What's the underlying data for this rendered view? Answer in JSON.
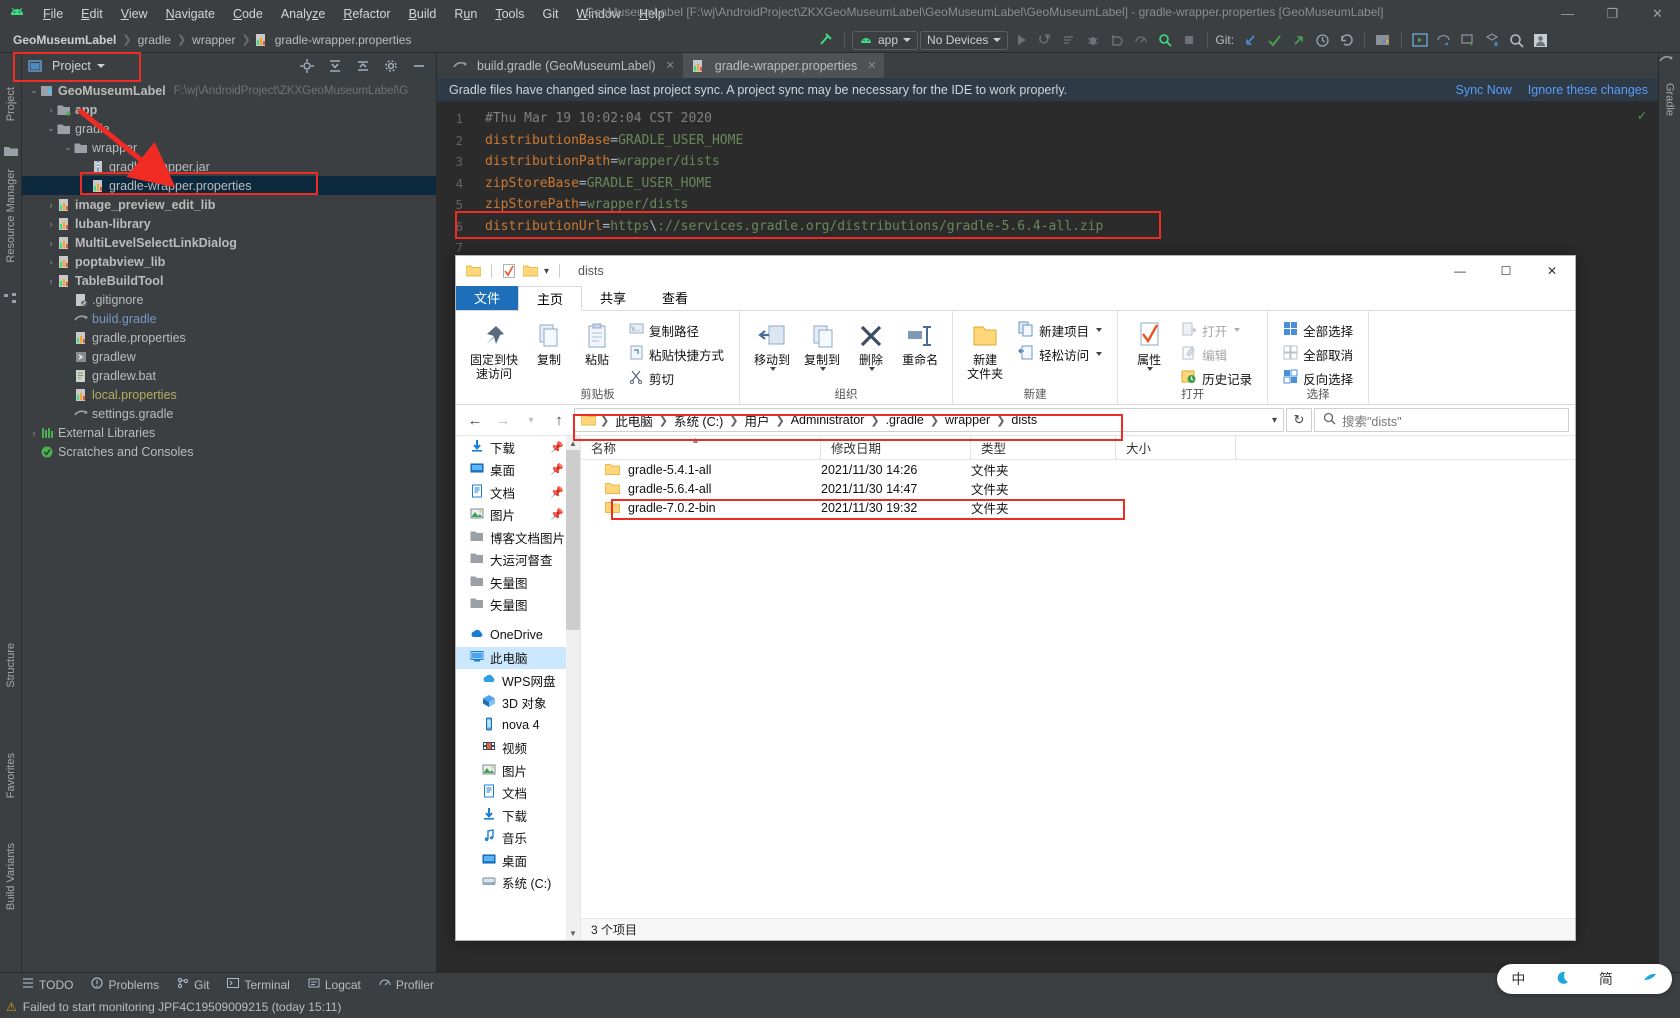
{
  "ide": {
    "title": "GeoMuseumLabel [F:\\wj\\AndroidProject\\ZKXGeoMuseumLabel\\GeoMuseumLabel\\GeoMuseumLabel] - gradle-wrapper.properties [GeoMuseumLabel]",
    "menu": [
      "File",
      "Edit",
      "View",
      "Navigate",
      "Code",
      "Analyze",
      "Refactor",
      "Build",
      "Run",
      "Tools",
      "Git",
      "Window",
      "Help"
    ],
    "window_buttons": {
      "minimize": "—",
      "maximize": "❐",
      "close": "✕"
    },
    "breadcrumb": [
      "GeoMuseumLabel",
      "gradle",
      "wrapper",
      "gradle-wrapper.properties"
    ],
    "toolbar": {
      "module_select": "app",
      "device_select": "No Devices",
      "git_label": "Git:"
    },
    "project_panel": {
      "title": "Project",
      "tree": [
        {
          "label": "GeoMuseumLabel",
          "sub": "F:\\wj\\AndroidProject\\ZKXGeoMuseumLabel\\G",
          "indent": 0,
          "arrow": "⌄",
          "icon": "module-icon",
          "bold": true
        },
        {
          "label": "app",
          "sub": "",
          "indent": 1,
          "arrow": "›",
          "icon": "folder-green-icon",
          "bold": true
        },
        {
          "label": "gradle",
          "sub": "",
          "indent": 1,
          "arrow": "⌄",
          "icon": "folder-icon",
          "bold": false
        },
        {
          "label": "wrapper",
          "sub": "",
          "indent": 2,
          "arrow": "⌄",
          "icon": "folder-icon",
          "bold": false
        },
        {
          "label": "gradle-wrapper.jar",
          "sub": "",
          "indent": 3,
          "arrow": "",
          "icon": "jar-icon",
          "bold": false
        },
        {
          "label": "gradle-wrapper.properties",
          "sub": "",
          "indent": 3,
          "arrow": "",
          "icon": "properties-icon",
          "bold": false,
          "selected": true
        },
        {
          "label": "image_preview_edit_lib",
          "sub": "",
          "indent": 1,
          "arrow": "›",
          "icon": "properties-icon",
          "bold": true
        },
        {
          "label": "luban-library",
          "sub": "",
          "indent": 1,
          "arrow": "›",
          "icon": "properties-icon",
          "bold": true
        },
        {
          "label": "MultiLevelSelectLinkDialog",
          "sub": "",
          "indent": 1,
          "arrow": "›",
          "icon": "properties-icon",
          "bold": true
        },
        {
          "label": "poptabview_lib",
          "sub": "",
          "indent": 1,
          "arrow": "›",
          "icon": "properties-icon",
          "bold": true
        },
        {
          "label": "TableBuildTool",
          "sub": "",
          "indent": 1,
          "arrow": "›",
          "icon": "properties-icon",
          "bold": true
        },
        {
          "label": ".gitignore",
          "sub": "",
          "indent": 2,
          "arrow": "",
          "icon": "gitignore-icon",
          "bold": false
        },
        {
          "label": "build.gradle",
          "sub": "",
          "indent": 2,
          "arrow": "",
          "icon": "gradle-icon",
          "bold": false,
          "color": "blue"
        },
        {
          "label": "gradle.properties",
          "sub": "",
          "indent": 2,
          "arrow": "",
          "icon": "properties-icon",
          "bold": false
        },
        {
          "label": "gradlew",
          "sub": "",
          "indent": 2,
          "arrow": "",
          "icon": "script-icon",
          "bold": false
        },
        {
          "label": "gradlew.bat",
          "sub": "",
          "indent": 2,
          "arrow": "",
          "icon": "bat-icon",
          "bold": false
        },
        {
          "label": "local.properties",
          "sub": "",
          "indent": 2,
          "arrow": "",
          "icon": "properties-icon",
          "bold": false,
          "color": "olive"
        },
        {
          "label": "settings.gradle",
          "sub": "",
          "indent": 2,
          "arrow": "",
          "icon": "gradle-icon",
          "bold": false
        },
        {
          "label": "External Libraries",
          "sub": "",
          "indent": 0,
          "arrow": "›",
          "icon": "libraries-icon",
          "bold": false
        },
        {
          "label": "Scratches and Consoles",
          "sub": "",
          "indent": 0,
          "arrow": "",
          "icon": "scratches-icon",
          "bold": false
        }
      ]
    },
    "left_rail": [
      "Project",
      "Resource Manager",
      "Structure",
      "Favorites",
      "Build Variants"
    ],
    "right_rail": [
      "Gradle"
    ],
    "editor": {
      "tabs": [
        {
          "label": "build.gradle (GeoMuseumLabel)",
          "icon": "gradle-icon",
          "active": false
        },
        {
          "label": "gradle-wrapper.properties",
          "icon": "properties-icon",
          "active": true
        }
      ],
      "notification": {
        "text": "Gradle files have changed since last project sync. A project sync may be necessary for the IDE to work properly.",
        "actions": [
          "Sync Now",
          "Ignore these changes"
        ]
      },
      "line_numbers": [
        "1",
        "2",
        "3",
        "4",
        "5",
        "6",
        "7"
      ],
      "lines": [
        {
          "type": "comment",
          "text": "#Thu Mar 19 10:02:04 CST 2020"
        },
        {
          "type": "kv",
          "key": "distributionBase",
          "value": "GRADLE_USER_HOME"
        },
        {
          "type": "kv",
          "key": "distributionPath",
          "value": "wrapper/dists"
        },
        {
          "type": "kv",
          "key": "zipStoreBase",
          "value": "GRADLE_USER_HOME"
        },
        {
          "type": "kv",
          "key": "zipStorePath",
          "value": "wrapper/dists"
        },
        {
          "type": "kv",
          "key": "distributionUrl",
          "value": "https\\://services.gradle.org/distributions/gradle-5.6.4-all.zip"
        },
        {
          "type": "empty",
          "text": ""
        }
      ]
    },
    "bottom_bar": [
      {
        "label": "TODO",
        "icon": "todo-icon"
      },
      {
        "label": "Problems",
        "icon": "problems-icon"
      },
      {
        "label": "Git",
        "icon": "git-icon"
      },
      {
        "label": "Terminal",
        "icon": "terminal-icon"
      },
      {
        "label": "Logcat",
        "icon": "logcat-icon"
      },
      {
        "label": "Profiler",
        "icon": "profiler-icon"
      }
    ],
    "status_text": "Failed to start monitoring JPF4C19509009215 (today 15:11)"
  },
  "explorer": {
    "window_title": "dists",
    "window_buttons": {
      "minimize": "—",
      "maximize": "☐",
      "close": "✕"
    },
    "ribbon_tabs": [
      "文件",
      "主页",
      "共享",
      "查看"
    ],
    "ribbon_groups": [
      {
        "name": "剪贴板",
        "big": [
          {
            "label": "固定到快\n速访问",
            "icon": "pin-icon"
          },
          {
            "label": "复制",
            "icon": "copy-icon"
          },
          {
            "label": "粘贴",
            "icon": "paste-icon"
          }
        ],
        "small": [
          "复制路径",
          "粘贴快捷方式",
          "剪切"
        ]
      },
      {
        "name": "组织",
        "big": [
          {
            "label": "移动到",
            "icon": "move-to-icon"
          },
          {
            "label": "复制到",
            "icon": "copy-to-icon"
          },
          {
            "label": "删除",
            "icon": "delete-icon"
          },
          {
            "label": "重命名",
            "icon": "rename-icon"
          }
        ],
        "small": []
      },
      {
        "name": "新建",
        "big": [
          {
            "label": "新建\n文件夹",
            "icon": "new-folder-icon"
          }
        ],
        "small": [
          "新建项目",
          "轻松访问"
        ]
      },
      {
        "name": "打开",
        "big": [
          {
            "label": "属性",
            "icon": "properties-icon"
          }
        ],
        "small": [
          "打开",
          "编辑",
          "历史记录"
        ]
      },
      {
        "name": "选择",
        "big": [],
        "small": [
          "全部选择",
          "全部取消",
          "反向选择"
        ]
      }
    ],
    "address": {
      "crumbs": [
        "此电脑",
        "系统 (C:)",
        "用户",
        "Administrator",
        ".gradle",
        "wrapper",
        "dists"
      ],
      "search_placeholder": "搜索\"dists\""
    },
    "nav_pane": [
      {
        "label": "下载",
        "icon": "download-icon",
        "pin": true,
        "indent": 0
      },
      {
        "label": "桌面",
        "icon": "desktop-icon",
        "pin": true,
        "indent": 0
      },
      {
        "label": "文档",
        "icon": "documents-icon",
        "pin": true,
        "indent": 0
      },
      {
        "label": "图片",
        "icon": "pictures-icon",
        "pin": true,
        "indent": 0
      },
      {
        "label": "博客文档图片",
        "icon": "folder-icon",
        "pin": false,
        "indent": 0
      },
      {
        "label": "大运河督查",
        "icon": "folder-icon",
        "pin": false,
        "indent": 0
      },
      {
        "label": "矢量图",
        "icon": "folder-icon",
        "pin": false,
        "indent": 0
      },
      {
        "label": "矢量图",
        "icon": "folder-icon",
        "pin": false,
        "indent": 0
      },
      {
        "label": "OneDrive",
        "icon": "onedrive-icon",
        "pin": false,
        "indent": 0,
        "gap": true
      },
      {
        "label": "此电脑",
        "icon": "this-pc-icon",
        "pin": false,
        "indent": 0,
        "selected": true
      },
      {
        "label": "WPS网盘",
        "icon": "wps-cloud-icon",
        "pin": false,
        "indent": 1
      },
      {
        "label": "3D 对象",
        "icon": "3d-objects-icon",
        "pin": false,
        "indent": 1
      },
      {
        "label": "nova 4",
        "icon": "phone-icon",
        "pin": false,
        "indent": 1
      },
      {
        "label": "视频",
        "icon": "videos-icon",
        "pin": false,
        "indent": 1
      },
      {
        "label": "图片",
        "icon": "pictures-icon",
        "pin": false,
        "indent": 1
      },
      {
        "label": "文档",
        "icon": "documents-icon",
        "pin": false,
        "indent": 1
      },
      {
        "label": "下载",
        "icon": "download-icon",
        "pin": false,
        "indent": 1
      },
      {
        "label": "音乐",
        "icon": "music-icon",
        "pin": false,
        "indent": 1
      },
      {
        "label": "桌面",
        "icon": "desktop-icon",
        "pin": false,
        "indent": 1
      },
      {
        "label": "系统 (C:)",
        "icon": "drive-icon",
        "pin": false,
        "indent": 1
      }
    ],
    "columns": [
      "名称",
      "修改日期",
      "类型",
      "大小"
    ],
    "files": [
      {
        "name": "gradle-5.4.1-all",
        "modified": "2021/11/30 14:26",
        "type": "文件夹",
        "size": ""
      },
      {
        "name": "gradle-5.6.4-all",
        "modified": "2021/11/30 14:47",
        "type": "文件夹",
        "size": "",
        "highlighted": true
      },
      {
        "name": "gradle-7.0.2-bin",
        "modified": "2021/11/30 19:32",
        "type": "文件夹",
        "size": ""
      }
    ],
    "status": "3 个项目"
  },
  "ime": {
    "items": [
      "中",
      "简"
    ]
  },
  "annotations": {
    "accent_color": "#ef2b24"
  }
}
